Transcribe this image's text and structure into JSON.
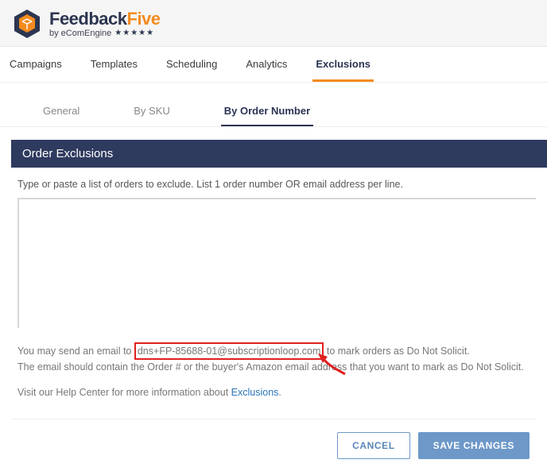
{
  "brand": {
    "name_dark": "Feedback",
    "name_orange": "Five",
    "byline": "by eComEngine",
    "stars": "★★★★★"
  },
  "nav": {
    "items": [
      {
        "label": "Campaigns",
        "active": false
      },
      {
        "label": "Templates",
        "active": false
      },
      {
        "label": "Scheduling",
        "active": false
      },
      {
        "label": "Analytics",
        "active": false
      },
      {
        "label": "Exclusions",
        "active": true
      }
    ]
  },
  "subtabs": {
    "items": [
      {
        "label": "General",
        "active": false
      },
      {
        "label": "By SKU",
        "active": false
      },
      {
        "label": "By Order Number",
        "active": true
      }
    ]
  },
  "section": {
    "title": "Order Exclusions"
  },
  "form": {
    "instruction": "Type or paste a list of orders to exclude. List 1 order number OR email address per line.",
    "textarea_value": "",
    "textarea_placeholder": ""
  },
  "hint": {
    "line1_pre": "You may send an email to ",
    "line1_email": "dns+FP-85688-01@subscriptionloop.com",
    "line1_post": " to mark orders as Do Not Solicit.",
    "line2": "The email should contain the Order # or the buyer's Amazon email address that you want to mark as Do Not Solicit.",
    "help_pre": "Visit our Help Center for more information about ",
    "help_link": "Exclusions",
    "help_post": "."
  },
  "buttons": {
    "cancel": "CANCEL",
    "save": "SAVE CHANGES"
  }
}
